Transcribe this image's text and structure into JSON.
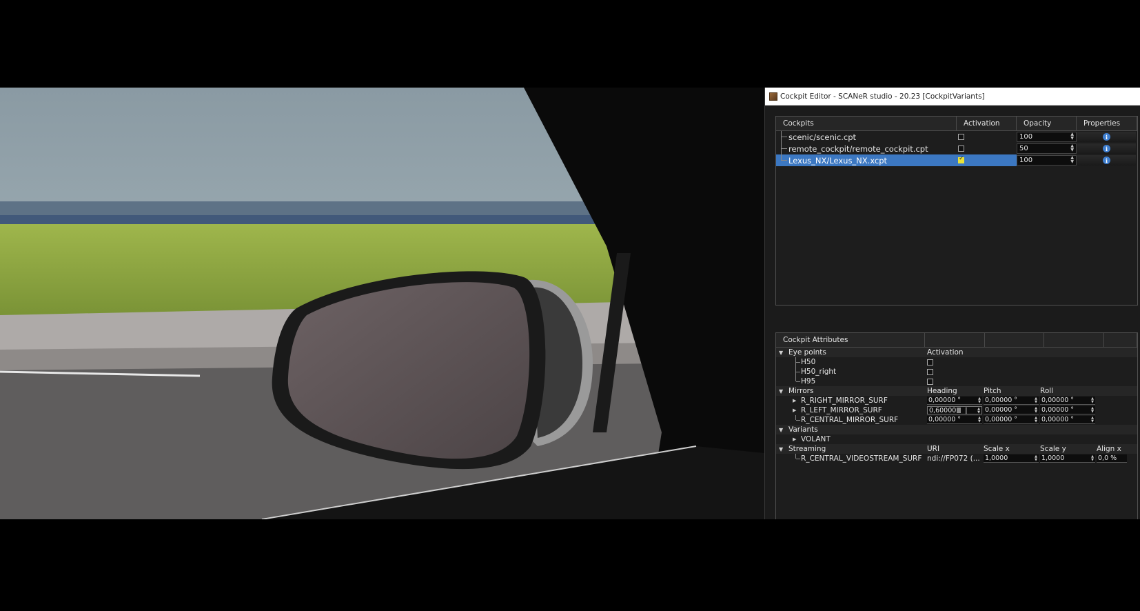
{
  "window": {
    "title": "Cockpit Editor - SCANeR studio - 20.23 [CockpitVariants]"
  },
  "cockpits": {
    "headers": {
      "name": "Cockpits",
      "activation": "Activation",
      "opacity": "Opacity",
      "properties": "Properties"
    },
    "rows": [
      {
        "name": "scenic/scenic.cpt",
        "active": false,
        "opacity": "100"
      },
      {
        "name": "remote_cockpit/remote_cockpit.cpt",
        "active": false,
        "opacity": "50"
      },
      {
        "name": "Lexus_NX/Lexus_NX.xcpt",
        "active": true,
        "opacity": "100"
      }
    ]
  },
  "attributes": {
    "title": "Cockpit Attributes",
    "eye_points": {
      "label": "Eye points",
      "col": "Activation",
      "items": [
        "H50",
        "H50_right",
        "H95"
      ]
    },
    "mirrors": {
      "label": "Mirrors",
      "heading": "Heading",
      "pitch": "Pitch",
      "roll": "Roll",
      "items": [
        {
          "name": "R_RIGHT_MIRROR_SURF",
          "heading": "0,00000 °",
          "pitch": "0,00000 °",
          "roll": "0,00000 °"
        },
        {
          "name": "R_LEFT_MIRROR_SURF",
          "heading": "0,60000",
          "pitch": "0,00000 °",
          "roll": "0,00000 °"
        },
        {
          "name": "R_CENTRAL_MIRROR_SURF",
          "heading": "0,00000 °",
          "pitch": "0,00000 °",
          "roll": "0,00000 °"
        }
      ]
    },
    "variants": {
      "label": "Variants",
      "items": [
        "VOLANT"
      ]
    },
    "streaming": {
      "label": "Streaming",
      "uri": "URI",
      "scale_x": "Scale x",
      "scale_y": "Scale y",
      "align_x": "Align x",
      "item": {
        "name": "R_CENTRAL_VIDEOSTREAM_SURF",
        "uri": "ndi://FP072 (...",
        "scale_x": "1,0000",
        "scale_y": "1,0000",
        "align_x": "0,0 %"
      }
    }
  }
}
